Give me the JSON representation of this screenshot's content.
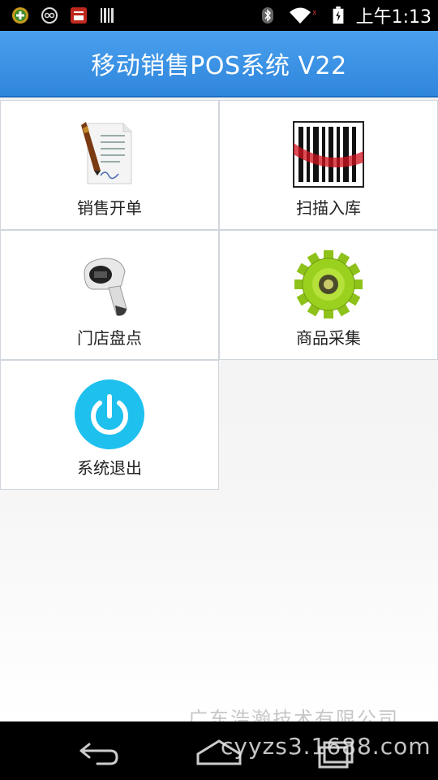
{
  "status_bar": {
    "time": "上午1:13",
    "icons": [
      "app-plus-icon",
      "glasses-icon",
      "red-app-icon",
      "barcode-app-icon",
      "bluetooth-icon",
      "wifi-icon",
      "battery-icon"
    ]
  },
  "header": {
    "title": "移动销售POS系统 V22"
  },
  "menu": {
    "items": [
      {
        "label": "销售开单",
        "icon": "sales-order-icon"
      },
      {
        "label": "扫描入库",
        "icon": "barcode-scan-icon"
      },
      {
        "label": "门店盘点",
        "icon": "barcode-scanner-icon"
      },
      {
        "label": "商品采集",
        "icon": "gear-icon"
      },
      {
        "label": "系统退出",
        "icon": "power-icon"
      }
    ]
  },
  "watermark": {
    "company": "广东浩瀚技术有限公司",
    "site": "cyyzs3.1688.com"
  },
  "nav_bar": {
    "buttons": [
      "back-icon",
      "home-icon",
      "recent-apps-icon"
    ]
  },
  "colors": {
    "header": "#2f86dc",
    "tile_border": "#cfd6dc",
    "power_button": "#1ec0ee",
    "gear": "#9ad11f"
  }
}
